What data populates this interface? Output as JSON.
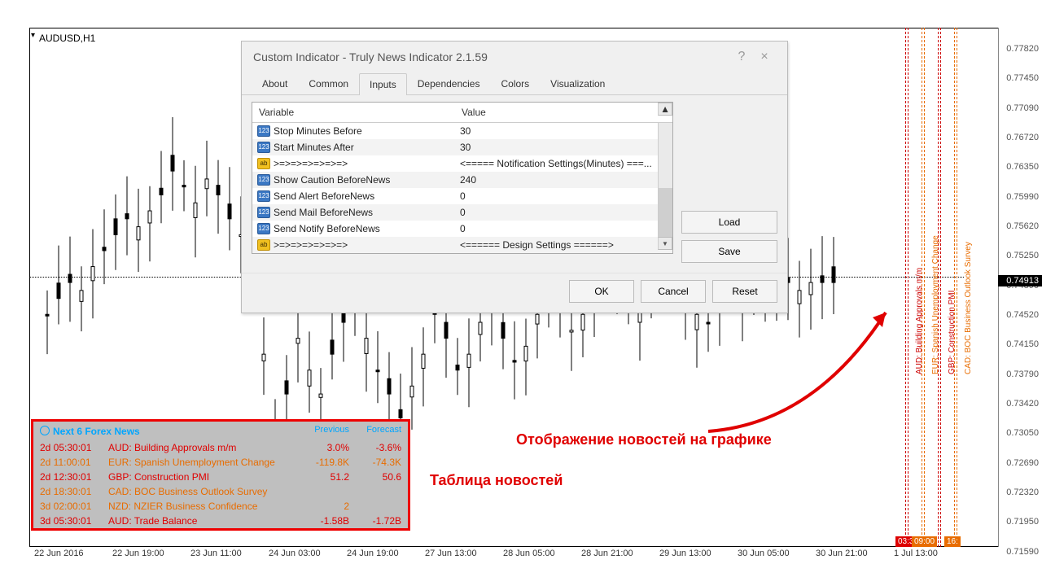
{
  "chart": {
    "symbol_tf": "AUDUSD,H1"
  },
  "price_axis": {
    "ticks": [
      "0.77820",
      "0.77450",
      "0.77090",
      "0.76720",
      "0.76350",
      "0.75990",
      "0.75620",
      "0.75250",
      "0.74890",
      "0.74520",
      "0.74150",
      "0.73790",
      "0.73420",
      "0.73050",
      "0.72690",
      "0.72320",
      "0.71950",
      "0.71590"
    ],
    "current": "0.74913"
  },
  "time_axis": [
    "22 Jun 2016",
    "22 Jun 19:00",
    "23 Jun 11:00",
    "24 Jun 03:00",
    "24 Jun 19:00",
    "27 Jun 13:00",
    "28 Jun 05:00",
    "28 Jun 21:00",
    "29 Jun 13:00",
    "30 Jun 05:00",
    "30 Jun 21:00",
    "1 Jul 13:00"
  ],
  "vlines": [
    {
      "label": "AUD: Building Approvals m/m",
      "color": "red",
      "time": "03:30"
    },
    {
      "label": "EUR: Spanish Unemployment Change",
      "color": "ora",
      "time": "09:00"
    },
    {
      "label": "GBP: Construction PMI",
      "color": "red",
      "time": ""
    },
    {
      "label": "CAD: BOC Business Outlook Survey",
      "color": "ora",
      "time": "16:"
    }
  ],
  "dialog": {
    "title": "Custom Indicator - Truly News Indicator 2.1.59",
    "tabs": [
      "About",
      "Common",
      "Inputs",
      "Dependencies",
      "Colors",
      "Visualization"
    ],
    "active_tab": 2,
    "head": {
      "variable": "Variable",
      "value": "Value"
    },
    "rows": [
      {
        "icon": "num",
        "name": "Stop Minutes Before",
        "val": "30"
      },
      {
        "icon": "num",
        "name": "Start Minutes After",
        "val": "30"
      },
      {
        "icon": "str",
        "name": ">=>=>=>=>=>=>",
        "val": "<===== Notification Settings(Minutes) ===..."
      },
      {
        "icon": "num",
        "name": "Show Caution BeforeNews",
        "val": "240"
      },
      {
        "icon": "num",
        "name": "Send Alert BeforeNews",
        "val": "0"
      },
      {
        "icon": "num",
        "name": "Send Mail BeforeNews",
        "val": "0"
      },
      {
        "icon": "num",
        "name": "Send Notify BeforeNews",
        "val": "0"
      },
      {
        "icon": "str",
        "name": ">=>=>=>=>=>=>",
        "val": "<====== Design Settings ======>"
      }
    ],
    "buttons": {
      "load": "Load",
      "save": "Save",
      "ok": "OK",
      "cancel": "Cancel",
      "reset": "Reset"
    }
  },
  "news": {
    "title": "Next 6 Forex News",
    "prev_h": "Previous",
    "fore_h": "Forecast",
    "rows": [
      {
        "cls": "red",
        "time": "2d 05:30:01",
        "name": "AUD: Building Approvals m/m",
        "prev": "3.0%",
        "fore": "-3.6%"
      },
      {
        "cls": "ora",
        "time": "2d 11:00:01",
        "name": "EUR: Spanish Unemployment Change",
        "prev": "-119.8K",
        "fore": "-74.3K"
      },
      {
        "cls": "red",
        "time": "2d 12:30:01",
        "name": "GBP: Construction PMI",
        "prev": "51.2",
        "fore": "50.6"
      },
      {
        "cls": "ora",
        "time": "2d 18:30:01",
        "name": "CAD: BOC Business Outlook Survey",
        "prev": "",
        "fore": ""
      },
      {
        "cls": "ora",
        "time": "3d 02:00:01",
        "name": "NZD: NZIER Business Confidence",
        "prev": "2",
        "fore": ""
      },
      {
        "cls": "red",
        "time": "3d 05:30:01",
        "name": "AUD: Trade Balance",
        "prev": "-1.58B",
        "fore": "-1.72B"
      }
    ]
  },
  "annotations": {
    "chart_news": "Отображение новостей на графике",
    "table_news": "Таблица новостей"
  }
}
